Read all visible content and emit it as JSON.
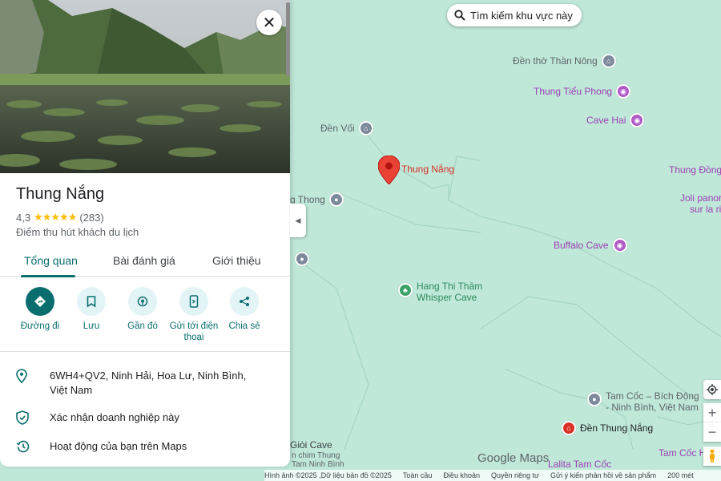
{
  "search_area": {
    "label": "Tìm kiếm khu vực này",
    "icon": "search-icon"
  },
  "map": {
    "main_pin_label": "Thung Nắng",
    "pois": [
      {
        "id": "den-tho-than-nong",
        "label": "Đền thờ Thần Nông",
        "style": "gray",
        "icon": "temple-icon"
      },
      {
        "id": "thung-tieu-phong",
        "label": "Thung Tiểu Phong",
        "style": "purple",
        "icon": "camera-icon"
      },
      {
        "id": "cave-hai",
        "label": "Cave Hai",
        "style": "purple",
        "icon": "camera-icon"
      },
      {
        "id": "den-voi",
        "label": "Đền Vối",
        "style": "gray",
        "icon": "temple-icon"
      },
      {
        "id": "thung-dong",
        "label": "Thung Đồng",
        "style": "purple",
        "icon": ""
      },
      {
        "id": "joli",
        "label": "Joli panor",
        "style": "purple",
        "icon": ""
      },
      {
        "id": "sur-la-ri",
        "label": "sur la ri",
        "style": "purple",
        "icon": ""
      },
      {
        "id": "thong",
        "label": "g Thong",
        "style": "gray",
        "icon": "pin-icon"
      },
      {
        "id": "unnamed-pin",
        "label": "",
        "style": "gray",
        "icon": "pin-icon"
      },
      {
        "id": "buffalo-cave",
        "label": "Buffalo Cave",
        "style": "purple",
        "icon": "camera-icon"
      },
      {
        "id": "hang-thi-tham",
        "label": "Hang Thi Thầm\nWhisper Cave",
        "style": "green",
        "icon": "park-icon"
      },
      {
        "id": "tam-coc",
        "label": "Tam Cốc – Bích Động\n- Ninh Bình, Việt Nam",
        "style": "gray",
        "icon": "pin-icon"
      },
      {
        "id": "den-thung-nang",
        "label": "Đền Thung Nắng",
        "style": "red",
        "icon": "temple-icon"
      },
      {
        "id": "gioi-cave",
        "label": "Giòi Cave",
        "style": "gray",
        "icon": ""
      },
      {
        "id": "chim-thung",
        "label": "n chim Thung\nTam Ninh Bình",
        "style": "gray",
        "icon": ""
      },
      {
        "id": "tam-coc-h",
        "label": "Tam Cốc H",
        "style": "purple",
        "icon": ""
      },
      {
        "id": "lalita",
        "label": "Lalita Tam Cốc",
        "style": "purple",
        "icon": ""
      }
    ]
  },
  "panel": {
    "close_icon": "close-icon",
    "title": "Thung Nắng",
    "rating": "4,3",
    "stars": "★★★★★",
    "review_count": "(283)",
    "category": "Điểm thu hút khách du lịch",
    "tabs": [
      "Tổng quan",
      "Bài đánh giá",
      "Giới thiệu"
    ],
    "active_tab": "Tổng quan",
    "actions": [
      {
        "label": "Đường đi",
        "icon": "directions-icon"
      },
      {
        "label": "Lưu",
        "icon": "bookmark-icon"
      },
      {
        "label": "Gần đó",
        "icon": "nearby-icon"
      },
      {
        "label": "Gửi tới điện thoại",
        "icon": "send-to-phone-icon"
      },
      {
        "label": "Chia sẻ",
        "icon": "share-icon"
      }
    ],
    "info": [
      {
        "icon": "location-icon",
        "text": "6WH4+QV2, Ninh Hải, Hoa Lư, Ninh Bình, Việt Nam"
      },
      {
        "icon": "verified-shield-icon",
        "text": "Xác nhận doanh nghiệp này"
      },
      {
        "icon": "history-icon",
        "text": "Hoạt động của bạn trên Maps"
      }
    ]
  },
  "branding": {
    "logo": "Google Maps"
  },
  "footer": {
    "items": [
      "Hình ảnh ©2025 ,Dữ liệu bản đồ ©2025",
      "Toàn cầu",
      "Điều khoản",
      "Quyền riêng tư",
      "Gửi ý kiến phản hồi về sản phẩm",
      "200 mét"
    ]
  }
}
